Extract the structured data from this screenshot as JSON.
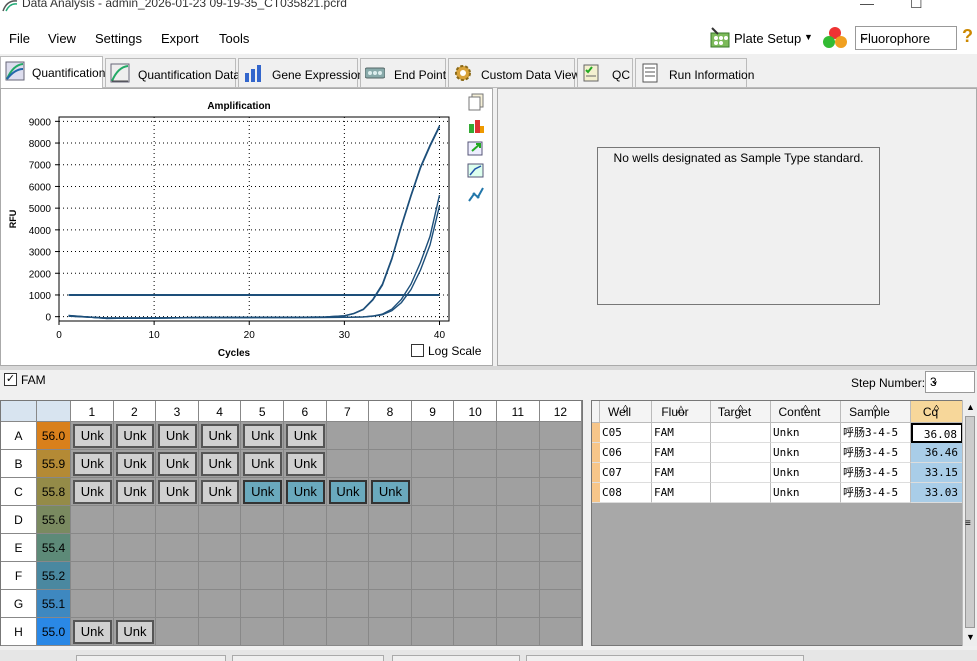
{
  "window": {
    "title": "Data Analysis - admin_2026-01-23 09-19-35_CT035821.pcrd",
    "minimize": "—",
    "maximize": "☐"
  },
  "menu": [
    "File",
    "View",
    "Settings",
    "Export",
    "Tools"
  ],
  "toolbar": {
    "plate_setup": "Plate Setup",
    "fluorophore": "Fluorophore",
    "help": "?"
  },
  "tabs": [
    "Quantification",
    "Quantification Data",
    "Gene Expression",
    "End Point",
    "Custom Data View",
    "QC",
    "Run Information"
  ],
  "chart_data": {
    "type": "line",
    "title": "Amplification",
    "xlabel": "Cycles",
    "ylabel": "RFU",
    "xlim": [
      0,
      41
    ],
    "ylim": [
      -200,
      9200
    ],
    "xticks": [
      0,
      10,
      20,
      30,
      40
    ],
    "yticks": [
      0,
      1000,
      2000,
      3000,
      4000,
      5000,
      6000,
      7000,
      8000,
      9000
    ],
    "grid": true,
    "threshold": 1000,
    "threshold_range": [
      1,
      40
    ],
    "series": [
      {
        "x": [
          1,
          5,
          10,
          15,
          20,
          25,
          28,
          30,
          31,
          32,
          33,
          34,
          35,
          36,
          37,
          38,
          39,
          40
        ],
        "y": [
          60,
          -80,
          -60,
          -40,
          -40,
          -30,
          -10,
          40,
          150,
          350,
          800,
          1500,
          2700,
          4200,
          5600,
          6900,
          7900,
          8800
        ]
      },
      {
        "x": [
          1,
          5,
          10,
          15,
          20,
          25,
          28,
          30,
          31,
          32,
          33,
          34,
          35,
          36,
          37,
          38,
          39,
          40
        ],
        "y": [
          50,
          -80,
          -60,
          -40,
          -40,
          -30,
          -10,
          40,
          140,
          330,
          770,
          1450,
          2650,
          4150,
          5550,
          6850,
          7850,
          8750
        ]
      },
      {
        "x": [
          1,
          5,
          10,
          15,
          20,
          25,
          30,
          32,
          33,
          34,
          35,
          36,
          37,
          38,
          39,
          40
        ],
        "y": [
          30,
          -60,
          -60,
          -50,
          -40,
          -40,
          -30,
          -10,
          30,
          120,
          350,
          800,
          1500,
          2500,
          3700,
          5600
        ]
      },
      {
        "x": [
          1,
          5,
          10,
          15,
          20,
          25,
          30,
          32,
          33,
          34,
          35,
          36,
          37,
          38,
          39,
          40
        ],
        "y": [
          20,
          -60,
          -60,
          -50,
          -40,
          -40,
          -30,
          -10,
          20,
          90,
          280,
          650,
          1250,
          2150,
          3300,
          5100
        ]
      }
    ]
  },
  "log_scale_label": "Log Scale",
  "standards_message": "No wells designated as Sample Type standard.",
  "fam_label": "FAM",
  "fam_check": "✓",
  "step": {
    "label": "Step Number:",
    "value": "3"
  },
  "plate": {
    "columns": [
      "1",
      "2",
      "3",
      "4",
      "5",
      "6",
      "7",
      "8",
      "9",
      "10",
      "11",
      "12"
    ],
    "rows": [
      {
        "label": "A",
        "temp": "56.0",
        "temp_color": "#d9801c",
        "wells": [
          1,
          2,
          3,
          4,
          5,
          6
        ],
        "selected": []
      },
      {
        "label": "B",
        "temp": "55.9",
        "temp_color": "#b48a35",
        "wells": [
          1,
          2,
          3,
          4,
          5,
          6
        ],
        "selected": []
      },
      {
        "label": "C",
        "temp": "55.8",
        "temp_color": "#948b48",
        "wells": [
          1,
          2,
          3,
          4,
          5,
          6,
          7,
          8
        ],
        "selected": [
          5,
          6,
          7,
          8
        ]
      },
      {
        "label": "D",
        "temp": "55.6",
        "temp_color": "#7a8a60",
        "wells": [],
        "selected": []
      },
      {
        "label": "E",
        "temp": "55.4",
        "temp_color": "#5d8a78",
        "wells": [],
        "selected": []
      },
      {
        "label": "F",
        "temp": "55.2",
        "temp_color": "#4a88a0",
        "wells": [],
        "selected": []
      },
      {
        "label": "G",
        "temp": "55.1",
        "temp_color": "#3e88c0",
        "wells": [],
        "selected": []
      },
      {
        "label": "H",
        "temp": "55.0",
        "temp_color": "#2a88e6",
        "wells": [
          1,
          2
        ],
        "selected": []
      }
    ],
    "well_label": "Unk"
  },
  "results": {
    "headers": [
      "Well",
      "Fluor",
      "Target",
      "Content",
      "Sample",
      "Cq"
    ],
    "sort_glyphs": [
      "◊",
      "△",
      "◊",
      "◊",
      "◊",
      "◊"
    ],
    "rows": [
      {
        "well": "C05",
        "fluor": "FAM",
        "target": "",
        "content": "Unkn",
        "sample": "呼肠3-4-5",
        "cq": "36.08"
      },
      {
        "well": "C06",
        "fluor": "FAM",
        "target": "",
        "content": "Unkn",
        "sample": "呼肠3-4-5",
        "cq": "36.46"
      },
      {
        "well": "C07",
        "fluor": "FAM",
        "target": "",
        "content": "Unkn",
        "sample": "呼肠3-4-5",
        "cq": "33.15"
      },
      {
        "well": "C08",
        "fluor": "FAM",
        "target": "",
        "content": "Unkn",
        "sample": "呼肠3-4-5",
        "cq": "33.03"
      }
    ]
  }
}
